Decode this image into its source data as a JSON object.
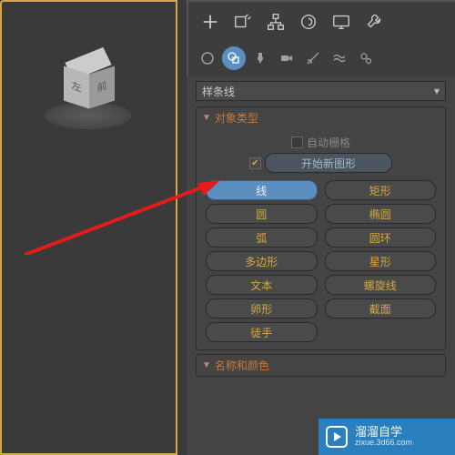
{
  "dropdown": {
    "label": "样条线"
  },
  "rollout1": {
    "title": "对象类型",
    "autogrid": "自动栅格",
    "newshape": "开始新图形",
    "buttons": [
      {
        "label": "线",
        "sel": true
      },
      {
        "label": "矩形"
      },
      {
        "label": "圆"
      },
      {
        "label": "椭圆"
      },
      {
        "label": "弧"
      },
      {
        "label": "圆环"
      },
      {
        "label": "多边形"
      },
      {
        "label": "星形"
      },
      {
        "label": "文本"
      },
      {
        "label": "螺旋线"
      },
      {
        "label": "卵形"
      },
      {
        "label": "截面"
      },
      {
        "label": "徒手"
      }
    ]
  },
  "rollout2": {
    "title": "名称和颜色"
  },
  "badge": {
    "main": "溜溜自学",
    "sub": "zixue.3d66.com"
  },
  "toolbar1": [
    "plus",
    "scale",
    "snap",
    "circle",
    "display",
    "wrench"
  ],
  "toolbar2": [
    "sphere",
    "shapes",
    "light",
    "camera",
    "helper",
    "waves",
    "gears"
  ]
}
